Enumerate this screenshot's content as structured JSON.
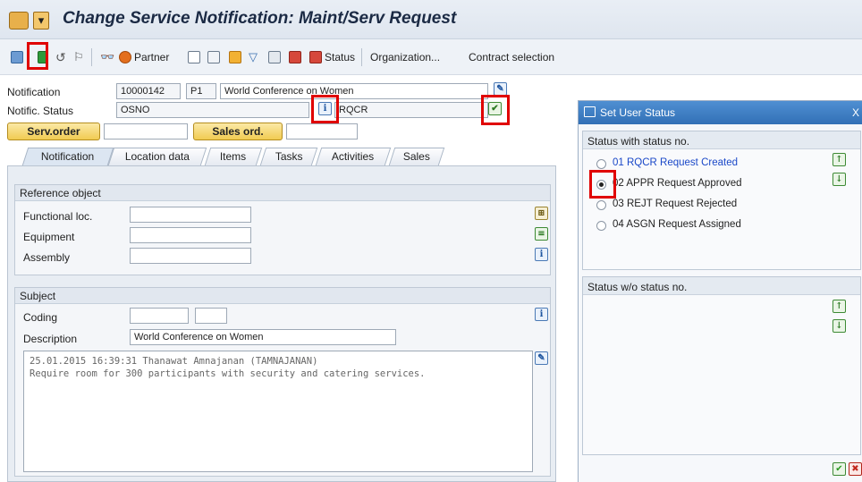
{
  "window": {
    "title": "Change Service Notification: Maint/Serv Request"
  },
  "toolbar": {
    "partner_label": "Partner",
    "status_label": "Status",
    "organization_label": "Organization...",
    "contract_label": "Contract selection"
  },
  "header": {
    "notification_label": "Notification",
    "notification_number": "10000142",
    "notification_type": "P1",
    "notification_text": "World Conference on Women",
    "status_label": "Notific. Status",
    "system_status": "OSNO",
    "user_status": "RQCR",
    "serv_order_label": "Serv.order",
    "sales_ord_label": "Sales ord."
  },
  "tabs": [
    {
      "label": "Notification"
    },
    {
      "label": "Location data"
    },
    {
      "label": "Items"
    },
    {
      "label": "Tasks"
    },
    {
      "label": "Activities"
    },
    {
      "label": "Sales"
    }
  ],
  "reference": {
    "title": "Reference object",
    "functional_loc_label": "Functional loc.",
    "equipment_label": "Equipment",
    "assembly_label": "Assembly"
  },
  "subject": {
    "title": "Subject",
    "coding_label": "Coding",
    "description_label": "Description",
    "description_value": "World Conference on Women",
    "log_line1": "25.01.2015 16:39:31 Thanawat Amnajanan (TAMNAJANAN)",
    "log_line2": "Require room for 300 participants with security and catering services."
  },
  "dialog": {
    "title": "Set User Status",
    "section1_title": "Status with status no.",
    "section2_title": "Status w/o status no.",
    "statuses": [
      {
        "text": "01 RQCR Request Created",
        "selected": false
      },
      {
        "text": "02 APPR Request Approved",
        "selected": true
      },
      {
        "text": "03 REJT Request Rejected",
        "selected": false
      },
      {
        "text": "04 ASGN Request Assigned",
        "selected": false
      }
    ]
  },
  "colors": {
    "highlight": "#e00000",
    "dialog_title_bg": "#3270b6",
    "status_created_text": "#1a48c8"
  }
}
